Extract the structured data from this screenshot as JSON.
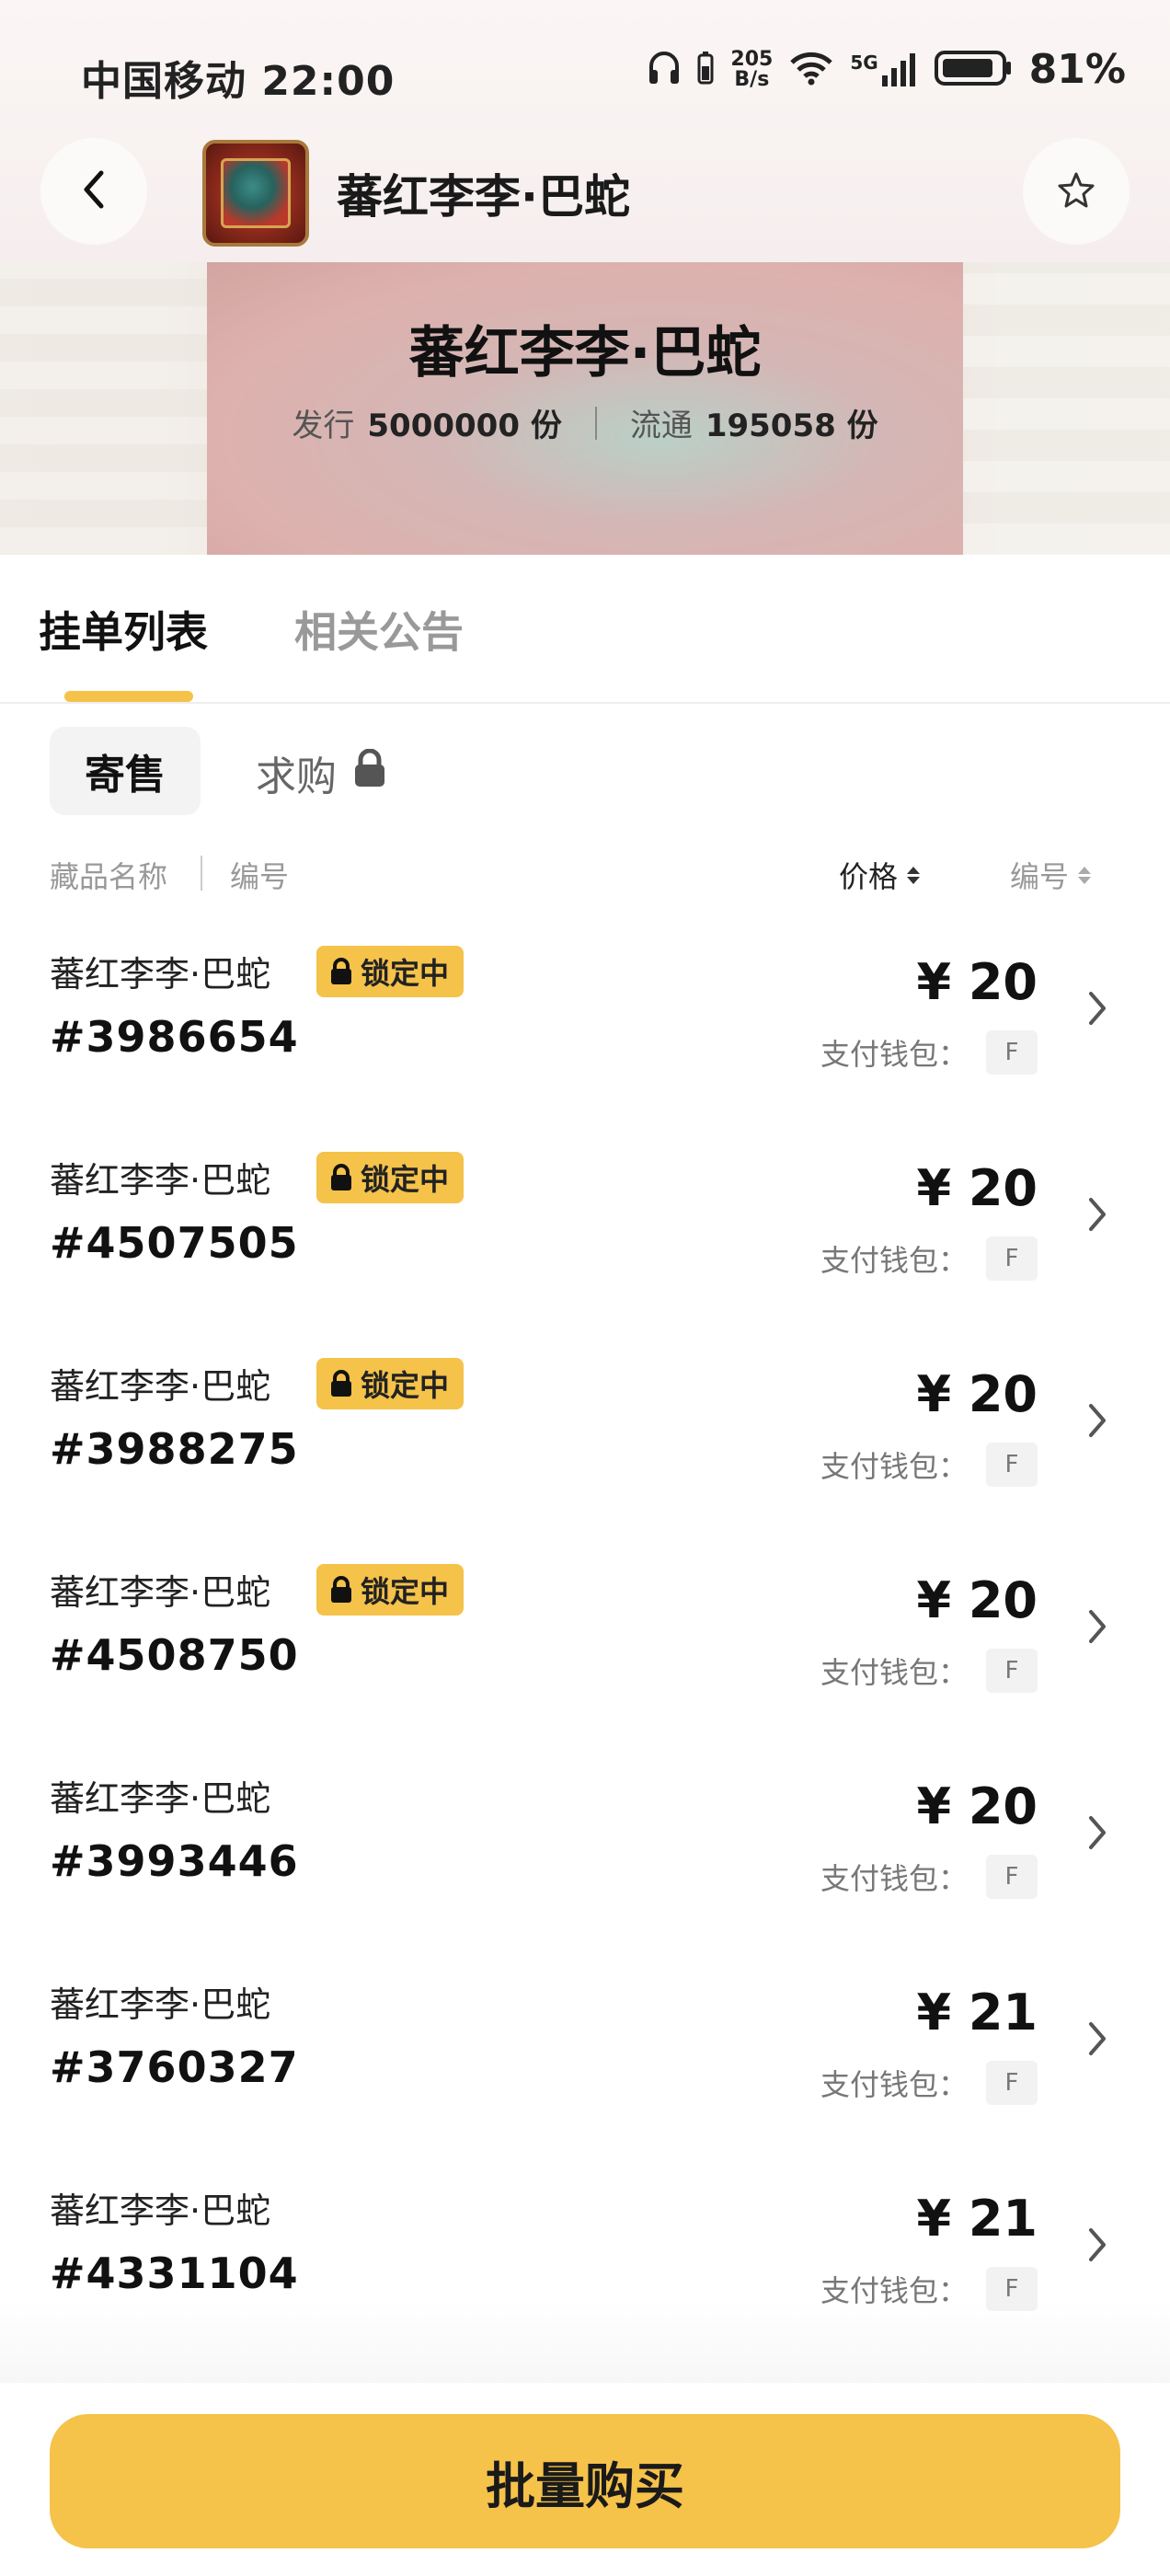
{
  "status_bar": {
    "carrier_time": "中国移动 22:00",
    "net_speed_value": "205",
    "net_speed_unit": "B/s",
    "signal_label": "5G",
    "battery": "81%"
  },
  "header": {
    "title": "蕃红李李·巴蛇"
  },
  "banner": {
    "title": "蕃红李李·巴蛇",
    "issue_label": "发行",
    "issue_value": "5000000 份",
    "circulation_label": "流通",
    "circulation_value": "195058 份"
  },
  "tabs": [
    {
      "label": "挂单列表",
      "active": true
    },
    {
      "label": "相关公告",
      "active": false
    }
  ],
  "sub_tabs": [
    {
      "label": "寄售",
      "active": true
    },
    {
      "label": "求购",
      "active": false,
      "locked": true
    }
  ],
  "columns": {
    "name": "藏品名称",
    "number": "编号",
    "price": "价格",
    "number_sort": "编号"
  },
  "listings": [
    {
      "name": "蕃红李李·巴蛇",
      "locked": true,
      "lock_label": "锁定中",
      "serial": "#3986654",
      "price": "¥ 20",
      "wallet_label": "支付钱包：",
      "wallet_tag": "F"
    },
    {
      "name": "蕃红李李·巴蛇",
      "locked": true,
      "lock_label": "锁定中",
      "serial": "#4507505",
      "price": "¥ 20",
      "wallet_label": "支付钱包：",
      "wallet_tag": "F"
    },
    {
      "name": "蕃红李李·巴蛇",
      "locked": true,
      "lock_label": "锁定中",
      "serial": "#3988275",
      "price": "¥ 20",
      "wallet_label": "支付钱包：",
      "wallet_tag": "F"
    },
    {
      "name": "蕃红李李·巴蛇",
      "locked": true,
      "lock_label": "锁定中",
      "serial": "#4508750",
      "price": "¥ 20",
      "wallet_label": "支付钱包：",
      "wallet_tag": "F"
    },
    {
      "name": "蕃红李李·巴蛇",
      "locked": false,
      "lock_label": "",
      "serial": "#3993446",
      "price": "¥ 20",
      "wallet_label": "支付钱包：",
      "wallet_tag": "F"
    },
    {
      "name": "蕃红李李·巴蛇",
      "locked": false,
      "lock_label": "",
      "serial": "#3760327",
      "price": "¥ 21",
      "wallet_label": "支付钱包：",
      "wallet_tag": "F"
    },
    {
      "name": "蕃红李李·巴蛇",
      "locked": false,
      "lock_label": "",
      "serial": "#4331104",
      "price": "¥ 21",
      "wallet_label": "支付钱包：",
      "wallet_tag": "F"
    }
  ],
  "bottom": {
    "buy_label": "批量购买"
  },
  "colors": {
    "accent": "#f5c24a",
    "text": "#111111",
    "muted": "#999999"
  },
  "icons": {
    "back": "chevron-left-icon",
    "favorite": "star-icon",
    "lock": "lock-icon",
    "row_arrow": "chevron-right-icon"
  }
}
